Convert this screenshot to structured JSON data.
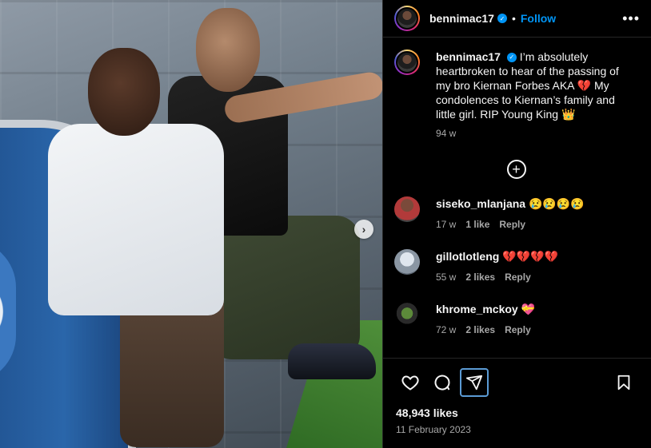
{
  "post": {
    "username": "bennimac17",
    "follow_label": "Follow",
    "dot": "•",
    "more_label": "•••",
    "next_label": "›"
  },
  "caption": {
    "username": "bennimac17",
    "text": "I’m absolutely heartbroken to hear of the passing of my bro Kiernan Forbes AKA 💔 My condolences to Kiernan’s family and little girl. RIP Young King 👑",
    "time": "94 w"
  },
  "load_more": "+",
  "comments": [
    {
      "user": "siseko_mlanjana",
      "text": "😢😢😢😢",
      "time": "17 w",
      "likes": "1 like",
      "reply": "Reply"
    },
    {
      "user": "gillotlotleng",
      "text": "💔💔💔💔",
      "time": "55 w",
      "likes": "2 likes",
      "reply": "Reply"
    },
    {
      "user": "khrome_mckoy",
      "text": "💝",
      "time": "72 w",
      "likes": "2 likes",
      "reply": "Reply"
    }
  ],
  "actions": {
    "icons": [
      "heart-icon",
      "comment-icon",
      "share-icon",
      "bookmark-icon"
    ],
    "likes": "48,943 likes",
    "date": "11 February 2023"
  },
  "colors": {
    "accent": "#0095f6",
    "background": "#000000",
    "text": "#f5f5f5",
    "muted": "#a8a8a8"
  }
}
